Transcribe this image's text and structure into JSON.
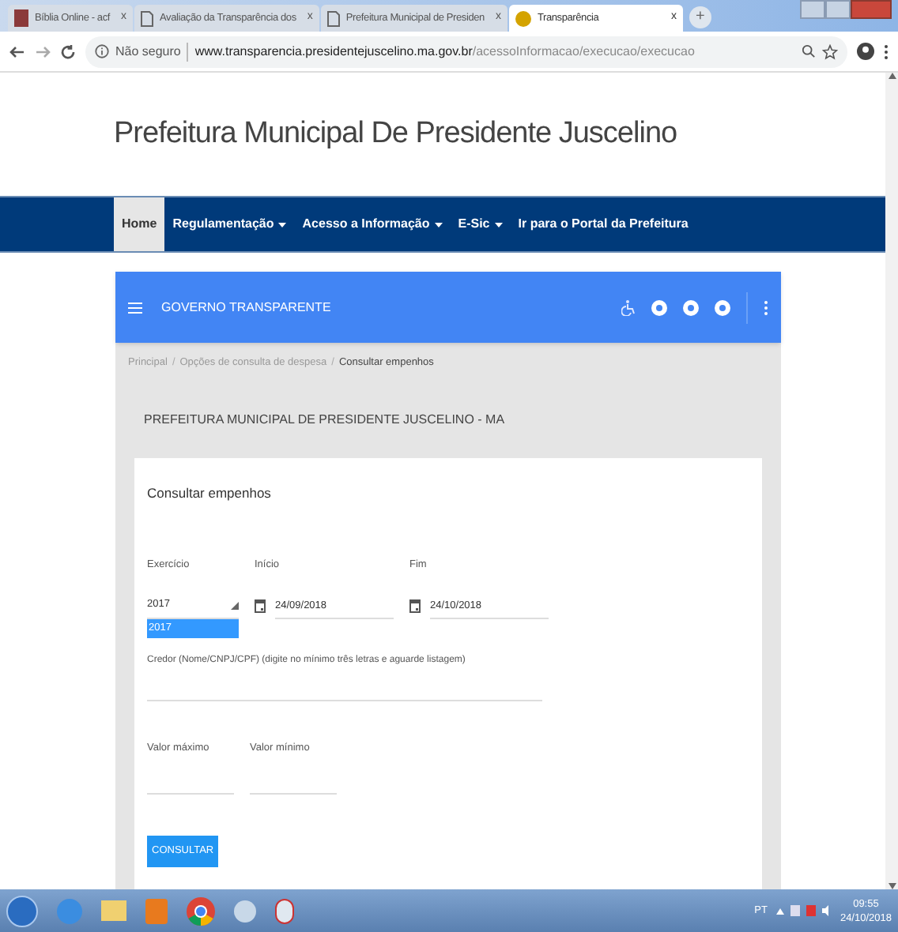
{
  "browser": {
    "tabs": [
      {
        "title": "Bíblia Online - acf",
        "selected": false,
        "kind": "book",
        "close_glyph": "x"
      },
      {
        "title": "Avaliação da Transparência dos",
        "selected": false,
        "kind": "page",
        "close_glyph": "x"
      },
      {
        "title": "Prefeitura Municipal de Presiden",
        "selected": false,
        "kind": "page",
        "close_glyph": "x"
      },
      {
        "title": "Transparência",
        "selected": true,
        "kind": "info",
        "close_glyph": "x"
      }
    ],
    "new_tab_glyph": "+",
    "security": "Não seguro",
    "url_host": "www.transparencia.presidentejuscelino.ma.gov.br",
    "url_path": "/acessoInformacao/execucao/execucao"
  },
  "site_title": "Prefeitura Municipal De Presidente Juscelino",
  "nav": [
    {
      "label": "Home",
      "selected": true,
      "dropdown": false
    },
    {
      "label": "Regulamentação",
      "selected": false,
      "dropdown": true
    },
    {
      "label": "Acesso a Informação",
      "selected": false,
      "dropdown": true
    },
    {
      "label": "E-Sic",
      "selected": false,
      "dropdown": true
    },
    {
      "label": "Ir para o Portal da Prefeitura",
      "selected": false,
      "dropdown": false
    }
  ],
  "app_bar": {
    "title": "GOVERNO TRANSPARENTE"
  },
  "breadcrumb": [
    {
      "label": "Principal",
      "current": false
    },
    {
      "label": "Opções de consulta de despesa",
      "current": false
    },
    {
      "label": "Consultar empenhos",
      "current": true
    }
  ],
  "breadcrumb_separator": "/",
  "entity": "PREFEITURA MUNICIPAL DE PRESIDENTE JUSCELINO - MA",
  "form": {
    "title": "Consultar empenhos",
    "exercicio": {
      "label": "Exercício",
      "value": "2017",
      "option": "2017"
    },
    "inicio": {
      "label": "Início",
      "value": "24/09/2018"
    },
    "fim": {
      "label": "Fim",
      "value": "24/10/2018"
    },
    "credor": {
      "label": "Credor (Nome/CNPJ/CPF) (digite no mínimo três letras e aguarde listagem)"
    },
    "valor_maximo": {
      "label": "Valor máximo"
    },
    "valor_minimo": {
      "label": "Valor mínimo"
    },
    "submit": "CONSULTAR"
  },
  "taskbar": {
    "language": "PT",
    "time": "09:55",
    "date": "24/10/2018"
  }
}
